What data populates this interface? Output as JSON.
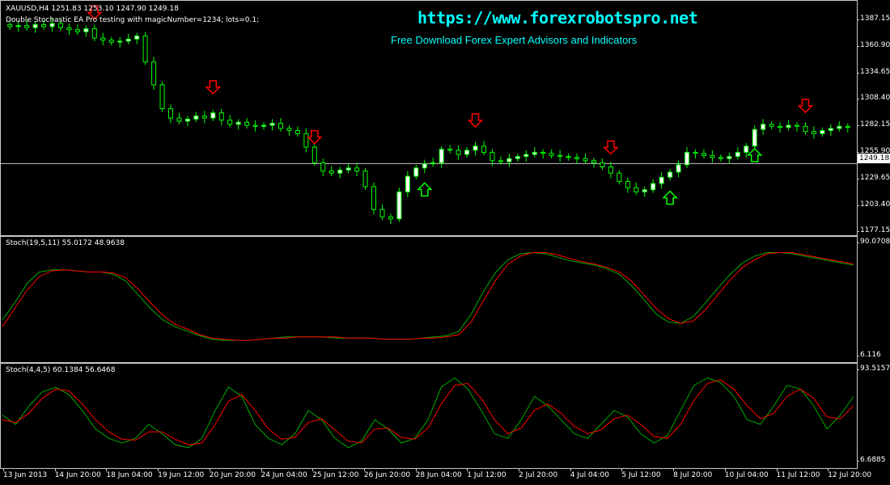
{
  "main": {
    "symbol_line": "XAUUSD,H4  1251.83 1253.10 1247.90 1249.18",
    "ea_line": "Double Stochastic EA Pro testing with magicNumber=1234; lots=0.1;",
    "watermark_url": "https://www.forexrobotspro.net",
    "watermark_sub": "Free Download Forex Expert Advisors and Indicators",
    "current_price": "1249.18",
    "price_ticks": [
      "1387.15",
      "1360.90",
      "1334.65",
      "1308.40",
      "1282.15",
      "1255.90",
      "1229.65",
      "1203.40",
      "1177.15"
    ]
  },
  "stoch1": {
    "label": "Stoch(19,5,11) 55.0172 48.9638",
    "max": "90.0708",
    "min": "6.116"
  },
  "stoch2": {
    "label": "Stoch(4,4,5) 60.1384 56.6468",
    "max": "93.5157",
    "min": "6.6885"
  },
  "time_axis": [
    "13 Jun 2013",
    "14 Jun 20:00",
    "18 Jun 04:00",
    "19 Jun 12:00",
    "20 Jun 20:00",
    "24 Jun 04:00",
    "25 Jun 12:00",
    "26 Jun 20:00",
    "28 Jun 04:00",
    "1 Jul 12:00",
    "2 Jul 20:00",
    "4 Jul 04:00",
    "5 Jul 12:00",
    "8 Jul 20:00",
    "10 Jul 04:00",
    "11 Jul 12:00",
    "12 Jul 20:00"
  ],
  "colors": {
    "bull": "#ffffff",
    "bear": "#000000",
    "wick": "#00ff00",
    "sell_arrow": "#ff0000",
    "buy_arrow": "#00ff00",
    "stoch_main": "#00aa00",
    "stoch_signal": "#ff0000",
    "watermark": "#00ffff"
  },
  "icons": {
    "sell": "down-arrow-icon",
    "buy": "up-arrow-icon"
  },
  "chart_data": [
    {
      "type": "candlestick",
      "title": "XAUUSD,H4",
      "ylim": [
        1177.15,
        1387.15
      ],
      "close": [
        1381,
        1382,
        1380,
        1383,
        1381,
        1384,
        1380,
        1378,
        1376,
        1379,
        1370,
        1368,
        1366,
        1367,
        1369,
        1372,
        1347,
        1325,
        1302,
        1293,
        1290,
        1292,
        1295,
        1293,
        1298,
        1291,
        1287,
        1289,
        1286,
        1285,
        1286,
        1288,
        1283,
        1281,
        1278,
        1265,
        1250,
        1242,
        1240,
        1243,
        1245,
        1242,
        1227,
        1205,
        1198,
        1196,
        1222,
        1237,
        1245,
        1249,
        1250,
        1263,
        1262,
        1258,
        1262,
        1266,
        1260,
        1252,
        1251,
        1254,
        1256,
        1258,
        1260,
        1259,
        1257,
        1256,
        1255,
        1254,
        1252,
        1250,
        1246,
        1240,
        1232,
        1226,
        1222,
        1224,
        1230,
        1236,
        1241,
        1248,
        1260,
        1259,
        1257,
        1255,
        1254,
        1256,
        1260,
        1266,
        1282,
        1287,
        1285,
        1284,
        1286,
        1285,
        1280,
        1278,
        1281,
        1283,
        1285,
        1284
      ],
      "sell_signals": [
        10,
        24,
        36,
        55,
        71,
        94
      ],
      "buy_signals": [
        49,
        78,
        88
      ]
    },
    {
      "type": "line",
      "title": "Stoch(19,5,11)",
      "ylim": [
        6.116,
        90.0708
      ],
      "series": [
        {
          "name": "",
          "values": [
            30,
            45,
            62,
            72,
            74,
            74,
            73,
            72,
            72,
            70,
            64,
            52,
            40,
            30,
            24,
            20,
            16,
            13,
            12,
            12,
            12,
            13,
            14,
            15,
            15,
            15,
            15,
            14,
            14,
            14,
            14,
            13,
            13,
            13,
            14,
            15,
            16,
            20,
            35,
            55,
            72,
            83,
            88,
            89,
            88,
            85,
            82,
            80,
            78,
            75,
            70,
            60,
            48,
            35,
            28,
            27,
            33,
            45,
            58,
            70,
            80,
            86,
            89,
            89,
            88,
            86,
            84,
            82,
            80,
            78
          ]
        },
        {
          "name": "",
          "values": [
            24,
            40,
            56,
            68,
            73,
            74,
            73,
            72,
            72,
            71,
            67,
            57,
            45,
            34,
            26,
            22,
            17,
            14,
            13,
            12,
            12,
            13,
            14,
            14,
            15,
            15,
            15,
            15,
            14,
            14,
            14,
            13,
            13,
            13,
            14,
            14,
            15,
            17,
            28,
            47,
            65,
            79,
            86,
            89,
            89,
            87,
            84,
            81,
            79,
            76,
            72,
            64,
            52,
            40,
            31,
            27,
            29,
            39,
            52,
            65,
            76,
            83,
            88,
            89,
            89,
            87,
            85,
            83,
            81,
            79
          ]
        }
      ]
    },
    {
      "type": "line",
      "title": "Stoch(4,4,5)",
      "ylim": [
        6.6885,
        93.5157
      ],
      "series": [
        {
          "name": "",
          "values": [
            50,
            40,
            60,
            75,
            80,
            72,
            55,
            35,
            25,
            20,
            25,
            40,
            30,
            18,
            15,
            25,
            55,
            80,
            70,
            40,
            25,
            18,
            30,
            55,
            45,
            25,
            15,
            22,
            45,
            35,
            20,
            25,
            45,
            80,
            90,
            78,
            55,
            30,
            25,
            45,
            70,
            60,
            45,
            30,
            25,
            40,
            55,
            48,
            30,
            20,
            28,
            55,
            82,
            90,
            85,
            70,
            45,
            40,
            60,
            82,
            78,
            60,
            35,
            50,
            70
          ]
        },
        {
          "name": "",
          "values": [
            45,
            42,
            52,
            68,
            78,
            76,
            62,
            45,
            32,
            24,
            23,
            32,
            32,
            24,
            18,
            20,
            40,
            65,
            72,
            55,
            35,
            24,
            26,
            42,
            46,
            34,
            22,
            20,
            35,
            36,
            26,
            24,
            36,
            62,
            82,
            84,
            68,
            45,
            30,
            36,
            55,
            62,
            52,
            38,
            30,
            34,
            46,
            50,
            40,
            27,
            25,
            40,
            66,
            84,
            88,
            78,
            60,
            46,
            52,
            70,
            78,
            68,
            48,
            46,
            60
          ]
        }
      ]
    }
  ]
}
